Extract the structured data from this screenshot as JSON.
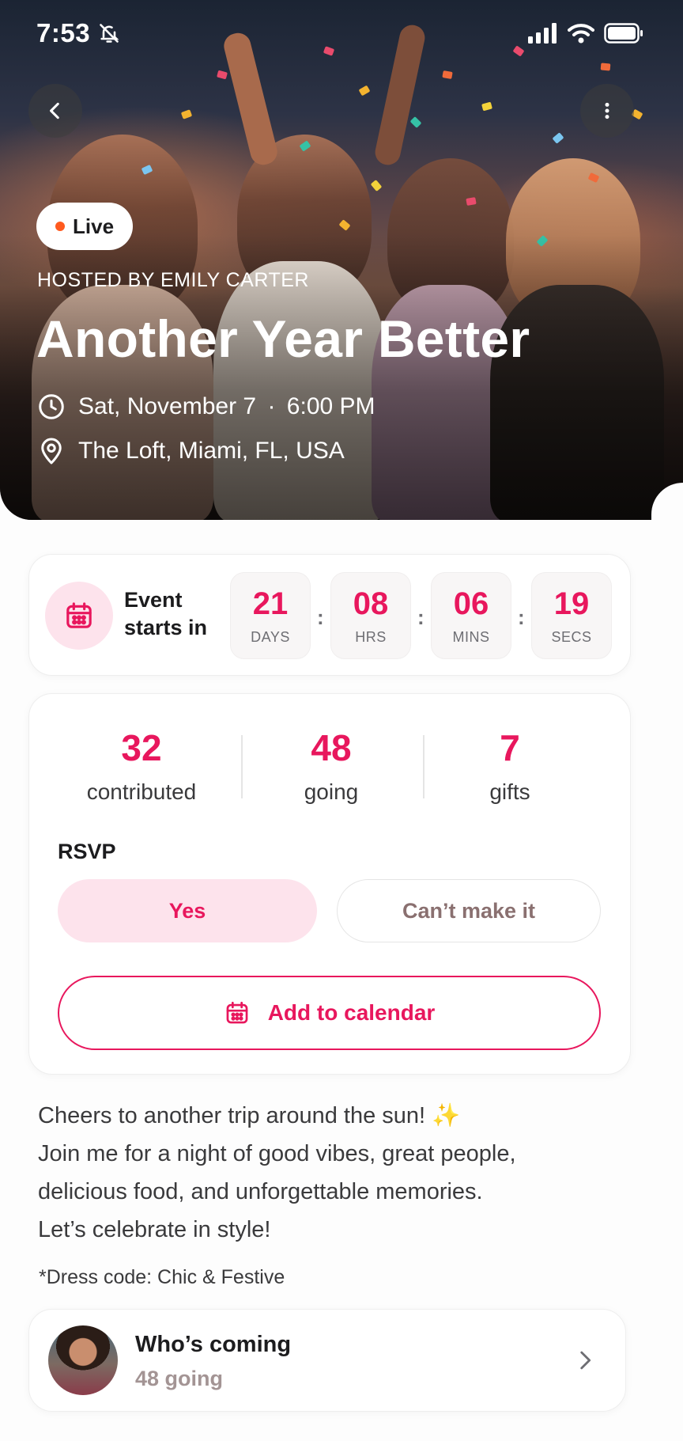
{
  "status_bar": {
    "time": "7:53"
  },
  "hero": {
    "live_label": "Live",
    "hosted_by": "HOSTED BY EMILY CARTER",
    "title": "Another Year Better",
    "date": "Sat, November 7",
    "separator": "·",
    "time": "6:00 PM",
    "location": "The Loft, Miami, FL, USA"
  },
  "countdown": {
    "label_line1": "Event",
    "label_line2": "starts in",
    "days": "21",
    "days_label": "DAYS",
    "hours": "08",
    "hours_label": "HRS",
    "minutes": "06",
    "minutes_label": "MINS",
    "seconds": "19",
    "seconds_label": "SECS",
    "colon": ":"
  },
  "stats": {
    "contributed_value": "32",
    "contributed_label": "contributed",
    "going_value": "48",
    "going_label": "going",
    "gifts_value": "7",
    "gifts_label": "gifts"
  },
  "rsvp": {
    "label": "RSVP",
    "yes_label": "Yes",
    "no_label": "Can’t make it",
    "add_to_calendar_label": "Add to calendar"
  },
  "description": {
    "line1": "Cheers to another trip around the sun!",
    "line1_emoji": "✨",
    "line2": "Join me for a night of good vibes, great people,",
    "line3": "delicious food, and unforgettable memories.",
    "line4": "Let’s celebrate in style!",
    "dress_code": "*Dress code: Chic & Festive"
  },
  "whos_coming": {
    "title": "Who’s coming",
    "count": "48 going"
  },
  "colors": {
    "accent": "#e8175d",
    "accent_soft": "#fde3ec",
    "live_dot": "#ff5a1f"
  },
  "icons": {
    "back": "chevron-left-icon",
    "more": "more-vertical-icon",
    "clock": "clock-icon",
    "location": "map-pin-icon",
    "calendar": "calendar-icon",
    "chevron": "chevron-right-icon"
  }
}
